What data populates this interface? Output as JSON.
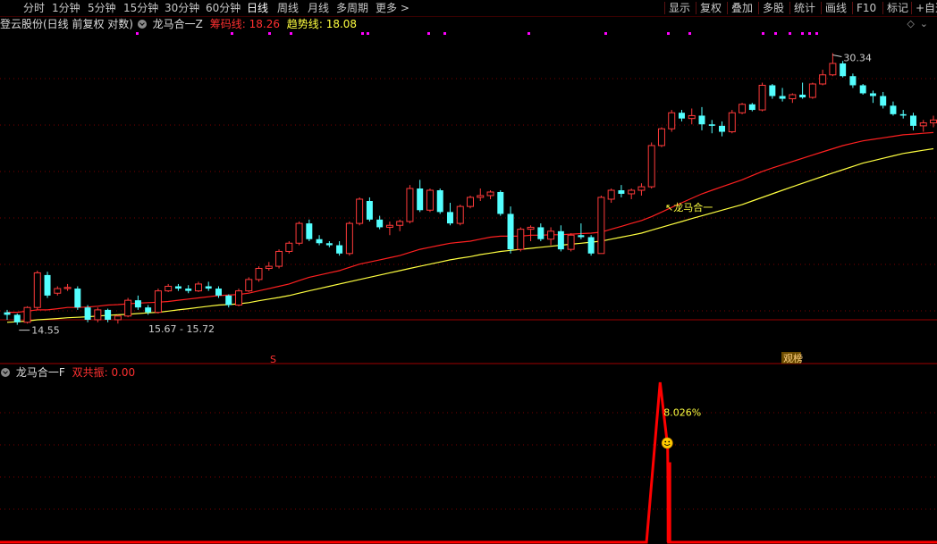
{
  "toolbar": {
    "left_items": [
      "分时",
      "1分钟",
      "5分钟",
      "15分钟",
      "30分钟",
      "60分钟",
      "日线",
      "周线",
      "月线",
      "多周期",
      "更多 >"
    ],
    "active": "日线",
    "right_items": [
      "显示",
      "复权",
      "叠加",
      "多股",
      "统计",
      "画线",
      "F10",
      "标记",
      "+自选"
    ]
  },
  "main_header": {
    "stock": "登云股份(日线 前复权 对数)",
    "indicator": "龙马合一Z",
    "chip_label": "筹码线",
    "chip_value": "18.26",
    "trend_label": "趋势线",
    "trend_value": "18.08"
  },
  "sub_header": {
    "indicator": "龙马合一F",
    "resonance_label": "双共振",
    "resonance_value": "0.00"
  },
  "annotations": {
    "high": "30.34",
    "low": "14.55",
    "range": "15.67 - 15.72",
    "signal": "龙马合一",
    "sub_peak": "8.026%",
    "marker_s": "S",
    "marker_news": "观榜"
  },
  "colors": {
    "up": "#ff3a3a",
    "down": "#54ffff",
    "chip_line": "#ff2020",
    "trend_line": "#ffff40",
    "grid": "#7a0000",
    "signal_line": "#ff0000",
    "dots": "#ff00ff"
  },
  "chart_data": [
    {
      "type": "candlestick",
      "title": "龙马合一Z",
      "y_scale": "log",
      "ylim": [
        13.8,
        31.5
      ],
      "ohlc": [
        [
          15.0,
          15.1,
          14.7,
          14.9
        ],
        [
          14.9,
          14.95,
          14.5,
          14.6
        ],
        [
          14.6,
          15.25,
          14.55,
          15.2
        ],
        [
          15.2,
          16.8,
          15.1,
          16.7
        ],
        [
          16.6,
          16.75,
          15.6,
          15.7
        ],
        [
          15.8,
          16.1,
          15.7,
          16.0
        ],
        [
          16.0,
          16.2,
          15.9,
          16.05
        ],
        [
          16.0,
          16.1,
          15.1,
          15.2
        ],
        [
          15.2,
          15.3,
          14.6,
          14.7
        ],
        [
          14.7,
          15.2,
          14.6,
          15.1
        ],
        [
          15.1,
          15.15,
          14.6,
          14.7
        ],
        [
          14.7,
          14.9,
          14.55,
          14.85
        ],
        [
          14.85,
          15.6,
          14.8,
          15.5
        ],
        [
          15.5,
          15.7,
          15.1,
          15.2
        ],
        [
          15.2,
          15.3,
          14.9,
          15.0
        ],
        [
          15.0,
          16.0,
          14.95,
          15.9
        ],
        [
          15.9,
          16.2,
          15.85,
          16.1
        ],
        [
          16.1,
          16.2,
          15.9,
          16.0
        ],
        [
          16.0,
          16.15,
          15.8,
          15.9
        ],
        [
          15.9,
          16.3,
          15.85,
          16.2
        ],
        [
          16.1,
          16.3,
          15.9,
          16.0
        ],
        [
          16.0,
          16.1,
          15.6,
          15.7
        ],
        [
          15.7,
          15.75,
          15.2,
          15.3
        ],
        [
          15.3,
          16.0,
          15.25,
          15.9
        ],
        [
          15.9,
          16.5,
          15.85,
          16.4
        ],
        [
          16.4,
          17.0,
          16.3,
          16.9
        ],
        [
          16.9,
          17.2,
          16.8,
          17.0
        ],
        [
          17.0,
          17.8,
          16.9,
          17.7
        ],
        [
          17.7,
          18.2,
          17.6,
          18.1
        ],
        [
          18.1,
          19.2,
          18.0,
          19.1
        ],
        [
          19.1,
          19.3,
          18.2,
          18.3
        ],
        [
          18.3,
          18.5,
          18.0,
          18.1
        ],
        [
          18.1,
          18.2,
          17.9,
          18.0
        ],
        [
          18.0,
          18.2,
          17.5,
          17.6
        ],
        [
          17.6,
          19.2,
          17.5,
          19.1
        ],
        [
          19.1,
          20.5,
          19.0,
          20.4
        ],
        [
          20.3,
          20.5,
          19.2,
          19.3
        ],
        [
          19.3,
          19.5,
          18.8,
          18.9
        ],
        [
          18.9,
          19.2,
          18.5,
          19.0
        ],
        [
          19.0,
          19.3,
          18.7,
          19.2
        ],
        [
          19.2,
          21.2,
          19.1,
          21.0
        ],
        [
          21.0,
          21.5,
          19.7,
          19.8
        ],
        [
          19.8,
          21.0,
          19.7,
          20.9
        ],
        [
          20.9,
          21.0,
          19.6,
          19.7
        ],
        [
          19.7,
          20.2,
          19.0,
          19.1
        ],
        [
          19.1,
          20.1,
          19.0,
          20.0
        ],
        [
          20.0,
          20.6,
          19.9,
          20.5
        ],
        [
          20.5,
          21.0,
          20.3,
          20.6
        ],
        [
          20.6,
          20.9,
          20.4,
          20.8
        ],
        [
          20.8,
          20.9,
          19.5,
          19.6
        ],
        [
          19.6,
          20.0,
          17.6,
          17.8
        ],
        [
          17.8,
          18.9,
          17.7,
          18.8
        ],
        [
          18.8,
          19.0,
          18.2,
          18.9
        ],
        [
          18.9,
          19.1,
          18.2,
          18.3
        ],
        [
          18.3,
          18.9,
          18.0,
          18.7
        ],
        [
          18.7,
          19.0,
          17.7,
          17.8
        ],
        [
          17.8,
          18.6,
          17.7,
          18.5
        ],
        [
          18.5,
          19.1,
          18.3,
          18.4
        ],
        [
          18.4,
          18.5,
          17.5,
          17.6
        ],
        [
          17.6,
          20.6,
          17.6,
          20.5
        ],
        [
          20.4,
          21.0,
          20.2,
          20.9
        ],
        [
          20.9,
          21.2,
          20.5,
          20.7
        ],
        [
          20.7,
          21.0,
          20.4,
          20.9
        ],
        [
          20.9,
          21.3,
          20.6,
          21.1
        ],
        [
          21.1,
          23.8,
          21.0,
          23.6
        ],
        [
          23.6,
          24.8,
          23.5,
          24.7
        ],
        [
          24.7,
          26.0,
          24.5,
          25.8
        ],
        [
          25.8,
          26.0,
          25.2,
          25.4
        ],
        [
          25.4,
          26.1,
          25.0,
          25.6
        ],
        [
          25.6,
          26.2,
          24.6,
          25.0
        ],
        [
          25.0,
          25.3,
          24.4,
          24.9
        ],
        [
          24.9,
          25.2,
          24.2,
          24.5
        ],
        [
          24.5,
          26.0,
          24.4,
          25.8
        ],
        [
          25.8,
          26.5,
          25.7,
          26.4
        ],
        [
          26.4,
          26.5,
          25.9,
          26.0
        ],
        [
          26.0,
          28.0,
          25.9,
          27.8
        ],
        [
          27.8,
          27.9,
          26.8,
          27.0
        ],
        [
          27.0,
          27.6,
          26.6,
          26.8
        ],
        [
          26.8,
          27.2,
          26.5,
          27.1
        ],
        [
          27.1,
          28.0,
          26.8,
          26.9
        ],
        [
          26.9,
          28.0,
          26.8,
          27.9
        ],
        [
          27.9,
          29.0,
          27.8,
          28.6
        ],
        [
          28.6,
          30.34,
          28.5,
          29.5
        ],
        [
          29.5,
          29.7,
          28.4,
          28.5
        ],
        [
          28.5,
          28.7,
          27.6,
          27.8
        ],
        [
          27.8,
          27.9,
          27.1,
          27.2
        ],
        [
          27.2,
          27.4,
          26.5,
          27.0
        ],
        [
          27.0,
          27.3,
          26.1,
          26.3
        ],
        [
          26.3,
          26.6,
          25.6,
          25.7
        ],
        [
          25.7,
          26.0,
          25.4,
          25.6
        ],
        [
          25.6,
          25.8,
          24.6,
          24.9
        ],
        [
          24.9,
          25.3,
          24.5,
          25.1
        ],
        [
          25.1,
          25.6,
          24.8,
          25.3
        ]
      ],
      "chip_line": [
        15.0,
        15.0,
        15.05,
        15.1,
        15.1,
        15.15,
        15.2,
        15.2,
        15.22,
        15.25,
        15.3,
        15.32,
        15.35,
        15.38,
        15.4,
        15.42,
        15.45,
        15.5,
        15.55,
        15.6,
        15.65,
        15.7,
        15.72,
        15.75,
        15.8,
        15.9,
        16.0,
        16.1,
        16.2,
        16.35,
        16.5,
        16.6,
        16.7,
        16.8,
        16.95,
        17.1,
        17.2,
        17.3,
        17.4,
        17.5,
        17.65,
        17.8,
        17.9,
        18.0,
        18.1,
        18.15,
        18.2,
        18.3,
        18.4,
        18.45,
        18.45,
        18.45,
        18.5,
        18.5,
        18.52,
        18.52,
        18.55,
        18.58,
        18.6,
        18.65,
        18.8,
        18.95,
        19.1,
        19.25,
        19.45,
        19.7,
        19.95,
        20.2,
        20.45,
        20.7,
        20.9,
        21.1,
        21.3,
        21.5,
        21.75,
        22.0,
        22.2,
        22.4,
        22.6,
        22.8,
        23.0,
        23.2,
        23.4,
        23.6,
        23.75,
        23.9,
        24.0,
        24.1,
        24.2,
        24.3,
        24.35,
        24.4,
        24.45
      ],
      "trend_line": [
        14.6,
        14.62,
        14.65,
        14.7,
        14.72,
        14.75,
        14.78,
        14.8,
        14.82,
        14.85,
        14.88,
        14.9,
        14.92,
        14.95,
        14.98,
        15.0,
        15.05,
        15.1,
        15.15,
        15.2,
        15.25,
        15.3,
        15.32,
        15.35,
        15.4,
        15.48,
        15.55,
        15.62,
        15.7,
        15.8,
        15.9,
        16.0,
        16.1,
        16.2,
        16.3,
        16.4,
        16.5,
        16.6,
        16.7,
        16.8,
        16.9,
        17.0,
        17.1,
        17.2,
        17.3,
        17.38,
        17.45,
        17.55,
        17.62,
        17.7,
        17.75,
        17.8,
        17.85,
        17.9,
        17.95,
        18.0,
        18.05,
        18.1,
        18.15,
        18.2,
        18.3,
        18.4,
        18.5,
        18.6,
        18.75,
        18.9,
        19.05,
        19.2,
        19.35,
        19.5,
        19.65,
        19.8,
        19.95,
        20.1,
        20.3,
        20.5,
        20.7,
        20.9,
        21.1,
        21.3,
        21.5,
        21.7,
        21.9,
        22.1,
        22.3,
        22.5,
        22.65,
        22.8,
        22.95,
        23.1,
        23.2,
        23.3,
        23.4
      ]
    },
    {
      "type": "line",
      "title": "龙马合一F",
      "ylim": [
        0,
        10
      ],
      "spike": {
        "start_index": 64,
        "peak_index": 65,
        "peak_value": 10.0,
        "label": "8.026%"
      }
    }
  ]
}
